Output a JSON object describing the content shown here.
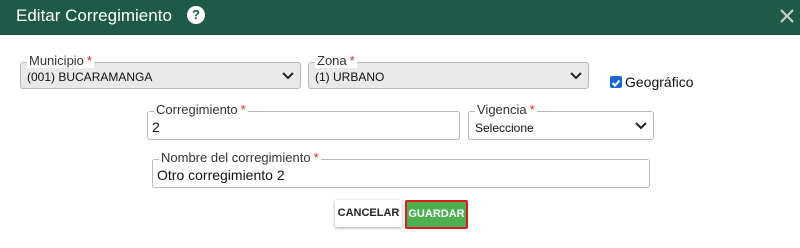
{
  "dialog": {
    "title": "Editar Corregimiento",
    "help_icon": "question-circle-icon",
    "close_icon": "close-icon"
  },
  "fields": {
    "municipio": {
      "label": "Municipio",
      "required": "*",
      "value": "(001) BUCARAMANGA"
    },
    "zona": {
      "label": "Zona",
      "required": "*",
      "value": "(1) URBANO"
    },
    "geografico": {
      "label": "Geográfico",
      "checked": true
    },
    "corregimiento": {
      "label": "Corregimiento",
      "required": "*",
      "value": "2"
    },
    "vigencia": {
      "label": "Vigencia",
      "required": "*",
      "value": "Seleccione"
    },
    "nombre": {
      "label": "Nombre del corregimiento",
      "required": "*",
      "value": "Otro corregimiento 2"
    }
  },
  "buttons": {
    "cancel": "CANCELAR",
    "save": "GUARDAR"
  },
  "colors": {
    "header": "#1e5a47",
    "save_button": "#4caf50",
    "highlight_border": "#e01b1b",
    "required": "#d9231f",
    "checkbox": "#1967d2"
  }
}
